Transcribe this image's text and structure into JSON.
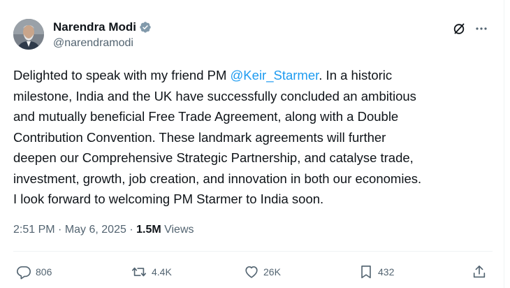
{
  "author": {
    "display_name": "Narendra Modi",
    "handle": "@narendramodi",
    "verified": true,
    "verified_color": "#829aab"
  },
  "tweet": {
    "line1_before": "Delighted to speak with my friend PM ",
    "mention": "@Keir_Starmer",
    "line1_after": ". In a historic",
    "lines": [
      "milestone, India and the UK have successfully concluded an ambitious",
      "and mutually beneficial Free Trade Agreement, along with a Double",
      "Contribution Convention. These landmark agreements will further",
      "deepen our Comprehensive Strategic Partnership, and catalyse trade,",
      "investment, growth, job creation, and innovation in both our economies.",
      "I look forward to welcoming PM Starmer to India soon."
    ],
    "mention_color": "#1d9bf0"
  },
  "meta": {
    "time": "2:51 PM",
    "separator": " · ",
    "date": "May 6, 2025",
    "views_count": "1.5M",
    "views_label": " Views"
  },
  "actions": {
    "replies": "806",
    "reposts": "4.4K",
    "likes": "26K",
    "bookmarks": "432"
  },
  "icons": {
    "top_right": [
      "grok-icon",
      "more-icon"
    ],
    "actions": [
      "reply-icon",
      "repost-icon",
      "like-icon",
      "bookmark-icon",
      "share-icon"
    ]
  }
}
